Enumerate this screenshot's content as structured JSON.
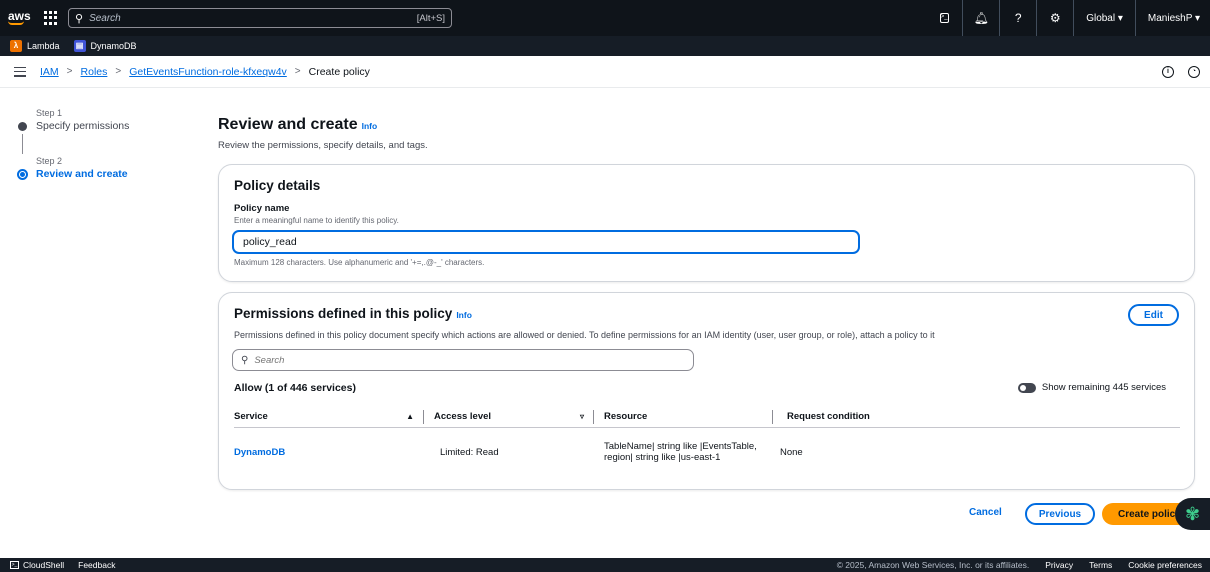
{
  "topnav": {
    "logo_text": "aws",
    "search_placeholder": "Search",
    "search_shortcut": "[Alt+S]",
    "region": "Global ▾",
    "user": "ManieshP ▾"
  },
  "favorites": [
    {
      "label": "Lambda",
      "color": "#ed7100"
    },
    {
      "label": "DynamoDB",
      "color": "#4053d6"
    }
  ],
  "breadcrumb": {
    "items": [
      "IAM",
      "Roles",
      "GetEventsFunction-role-kfxeqw4v"
    ],
    "current": "Create policy"
  },
  "steps": {
    "step1_label": "Step 1",
    "step1_name": "Specify permissions",
    "step2_label": "Step 2",
    "step2_name": "Review and create"
  },
  "page": {
    "title": "Review and create",
    "info": "Info",
    "description": "Review the permissions, specify details, and tags."
  },
  "policy_details": {
    "title": "Policy details",
    "name_label": "Policy name",
    "name_hint": "Enter a meaningful name to identify this policy.",
    "name_value": "policy_read",
    "constraint": "Maximum 128 characters. Use alphanumeric and '+=,.@-_' characters."
  },
  "permissions": {
    "title": "Permissions defined in this policy",
    "info": "Info",
    "edit_label": "Edit",
    "description": "Permissions defined in this policy document specify which actions are allowed or denied. To define permissions for an IAM identity (user, user group, or role), attach a policy to it",
    "search_placeholder": "Search",
    "allow_title": "Allow (1 of 446 services)",
    "toggle_label": "Show remaining 445 services",
    "columns": [
      "Service",
      "Access level",
      "Resource",
      "Request condition"
    ],
    "rows": [
      {
        "service": "DynamoDB",
        "access_level": "Limited: Read",
        "resource": "TableName| string like |EventsTable, region| string like |us-east-1",
        "condition": "None"
      }
    ]
  },
  "actions": {
    "cancel": "Cancel",
    "previous": "Previous",
    "create": "Create policy"
  },
  "footer": {
    "cloudshell": "CloudShell",
    "feedback": "Feedback",
    "copyright": "© 2025, Amazon Web Services, Inc. or its affiliates.",
    "privacy": "Privacy",
    "terms": "Terms",
    "cookies": "Cookie preferences"
  },
  "colors": {
    "nav_bg": "#0f141a",
    "link": "#006ce0",
    "primary_button": "#ff9900"
  }
}
